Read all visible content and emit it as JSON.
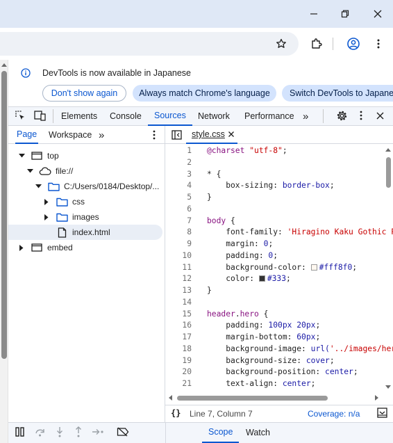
{
  "window": {
    "minimize_icon": "minimize-icon",
    "maximize_icon": "restore-icon",
    "close_icon": "close-icon"
  },
  "infobar": {
    "message": "DevTools is now available in Japanese",
    "buttons": [
      "Don't show again",
      "Always match Chrome's language",
      "Switch DevTools to Japanese"
    ]
  },
  "devtools": {
    "tabs": [
      "Elements",
      "Console",
      "Sources",
      "Network",
      "Performance"
    ],
    "active_tab": "Sources",
    "more": "»"
  },
  "navigator": {
    "tabs": [
      "Page",
      "Workspace"
    ],
    "active_tab": "Page",
    "tree": [
      {
        "label": "top",
        "depth": 0,
        "icon": "frame-icon",
        "arrow": "down"
      },
      {
        "label": "file://",
        "depth": 1,
        "icon": "cloud-icon",
        "arrow": "down"
      },
      {
        "label": "C:/Users/0184/Desktop/...",
        "depth": 2,
        "icon": "folder-icon",
        "arrow": "down"
      },
      {
        "label": "css",
        "depth": 3,
        "icon": "folder-icon",
        "arrow": "right"
      },
      {
        "label": "images",
        "depth": 3,
        "icon": "folder-icon",
        "arrow": "right"
      },
      {
        "label": "index.html",
        "depth": 3,
        "icon": "file-icon",
        "arrow": "none",
        "selected": true
      },
      {
        "label": "embed",
        "depth": 0,
        "icon": "frame-icon",
        "arrow": "right"
      }
    ]
  },
  "editor": {
    "file_tab": "style.css",
    "lines": [
      {
        "n": "1",
        "t": [
          [
            "at",
            "@charset "
          ],
          [
            "str",
            "\"utf-8\""
          ],
          [
            "sel",
            ";"
          ]
        ]
      },
      {
        "n": "2",
        "t": []
      },
      {
        "n": "3",
        "t": [
          [
            "sel",
            "* {"
          ]
        ]
      },
      {
        "n": "4",
        "t": [
          [
            "prop",
            "    box-sizing: "
          ],
          [
            "kw",
            "border-box"
          ],
          [
            "sel",
            ";"
          ]
        ]
      },
      {
        "n": "5",
        "t": [
          [
            "sel",
            "}"
          ]
        ]
      },
      {
        "n": "6",
        "t": []
      },
      {
        "n": "7",
        "t": [
          [
            "at",
            "body"
          ],
          [
            "sel",
            " {"
          ]
        ]
      },
      {
        "n": "8",
        "t": [
          [
            "prop",
            "    font-family: "
          ],
          [
            "str",
            "'Hiragino Kaku Gothic ProN'"
          ]
        ]
      },
      {
        "n": "9",
        "t": [
          [
            "prop",
            "    margin: "
          ],
          [
            "num",
            "0"
          ],
          [
            "sel",
            ";"
          ]
        ]
      },
      {
        "n": "10",
        "t": [
          [
            "prop",
            "    padding: "
          ],
          [
            "num",
            "0"
          ],
          [
            "sel",
            ";"
          ]
        ]
      },
      {
        "n": "11",
        "t": [
          [
            "prop",
            "    background-color: "
          ],
          [
            "sw",
            "#fff8f0"
          ],
          [
            "num",
            "#fff8f0"
          ],
          [
            "sel",
            ";"
          ]
        ]
      },
      {
        "n": "12",
        "t": [
          [
            "prop",
            "    color: "
          ],
          [
            "sw",
            "#333"
          ],
          [
            "num",
            "#333"
          ],
          [
            "sel",
            ";"
          ]
        ]
      },
      {
        "n": "13",
        "t": [
          [
            "sel",
            "}"
          ]
        ]
      },
      {
        "n": "14",
        "t": []
      },
      {
        "n": "15",
        "t": [
          [
            "at",
            "header"
          ],
          [
            "sel",
            "."
          ],
          [
            "at",
            "hero"
          ],
          [
            "sel",
            " {"
          ]
        ]
      },
      {
        "n": "16",
        "t": [
          [
            "prop",
            "    padding: "
          ],
          [
            "num",
            "100px 20px"
          ],
          [
            "sel",
            ";"
          ]
        ]
      },
      {
        "n": "17",
        "t": [
          [
            "prop",
            "    margin-bottom: "
          ],
          [
            "num",
            "60px"
          ],
          [
            "sel",
            ";"
          ]
        ]
      },
      {
        "n": "18",
        "t": [
          [
            "prop",
            "    background-image: "
          ],
          [
            "kw",
            "url("
          ],
          [
            "str",
            "'../images/hero.jpg'"
          ],
          [
            "kw",
            ")"
          ]
        ]
      },
      {
        "n": "19",
        "t": [
          [
            "prop",
            "    background-size: "
          ],
          [
            "kw",
            "cover"
          ],
          [
            "sel",
            ";"
          ]
        ]
      },
      {
        "n": "20",
        "t": [
          [
            "prop",
            "    background-position: "
          ],
          [
            "kw",
            "center"
          ],
          [
            "sel",
            ";"
          ]
        ]
      },
      {
        "n": "21",
        "t": [
          [
            "prop",
            "    text-align: "
          ],
          [
            "kw",
            "center"
          ],
          [
            "sel",
            ";"
          ]
        ]
      }
    ]
  },
  "status": {
    "braces": "{}",
    "position": "Line 7, Column 7",
    "coverage": "Coverage: n/a"
  },
  "bottom": {
    "tabs": [
      "Scope",
      "Watch"
    ],
    "active_tab": "Scope"
  }
}
